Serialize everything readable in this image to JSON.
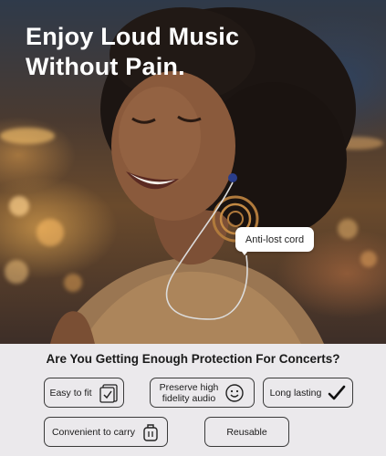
{
  "headline": {
    "line1": "Enjoy Loud Music",
    "line2": "Without Pain."
  },
  "callout": {
    "label": "Anti-lost cord"
  },
  "question": "Are You Getting Enough Protection For Concerts?",
  "features": {
    "easy_fit": {
      "label": "Easy to fit",
      "icon": "checkbox-tablet-icon"
    },
    "fidelity": {
      "label_line1": "Preserve high",
      "label_line2": "fidelity audio",
      "icon": "smiley-face-icon"
    },
    "long_lasting": {
      "label": "Long lasting",
      "icon": "checkmark-icon"
    },
    "carry": {
      "label": "Convenient to carry",
      "icon": "carry-case-icon"
    },
    "reusable": {
      "label": "Reusable"
    }
  },
  "colors": {
    "headline_text": "#ffffff",
    "panel_background": "#ebe9ec",
    "chip_border": "#3a3a3a"
  }
}
